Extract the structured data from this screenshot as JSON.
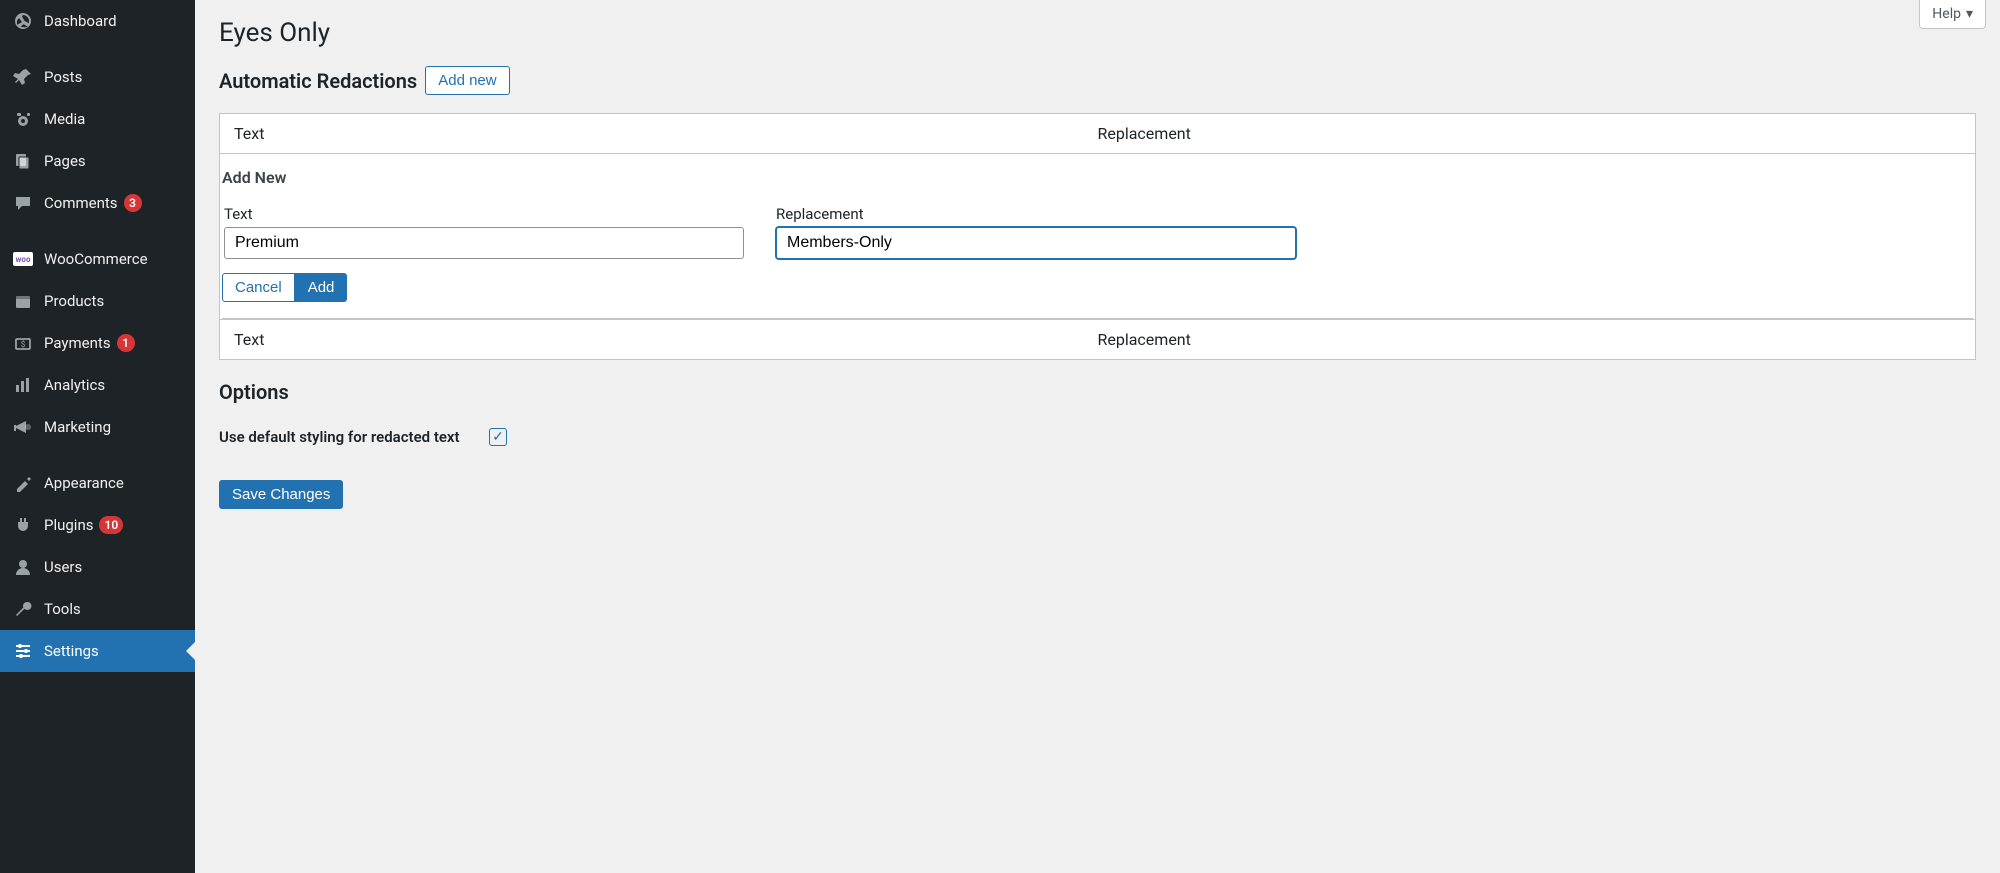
{
  "help": {
    "label": "Help"
  },
  "sidebar": {
    "items": [
      {
        "label": "Dashboard",
        "icon": "dashboard"
      },
      {
        "label": "Posts",
        "icon": "pin"
      },
      {
        "label": "Media",
        "icon": "media"
      },
      {
        "label": "Pages",
        "icon": "pages"
      },
      {
        "label": "Comments",
        "icon": "comment",
        "badge": "3"
      },
      {
        "label": "WooCommerce",
        "icon": "woo"
      },
      {
        "label": "Products",
        "icon": "products"
      },
      {
        "label": "Payments",
        "icon": "payments",
        "badge": "1"
      },
      {
        "label": "Analytics",
        "icon": "analytics"
      },
      {
        "label": "Marketing",
        "icon": "marketing"
      },
      {
        "label": "Appearance",
        "icon": "appearance"
      },
      {
        "label": "Plugins",
        "icon": "plugins",
        "badge": "10"
      },
      {
        "label": "Users",
        "icon": "users"
      },
      {
        "label": "Tools",
        "icon": "tools"
      },
      {
        "label": "Settings",
        "icon": "settings",
        "active": true
      }
    ]
  },
  "page": {
    "title": "Eyes Only",
    "redactions": {
      "heading": "Automatic Redactions",
      "add_new_btn": "Add new",
      "col_text": "Text",
      "col_replacement": "Replacement",
      "add_new_heading": "Add New",
      "text_label": "Text",
      "replacement_label": "Replacement",
      "text_value": "Premium",
      "replacement_value": "Members-Only",
      "cancel_btn": "Cancel",
      "add_btn": "Add"
    },
    "options": {
      "heading": "Options",
      "default_styling_label": "Use default styling for redacted text",
      "default_styling_checked": true
    },
    "save_btn": "Save Changes"
  }
}
